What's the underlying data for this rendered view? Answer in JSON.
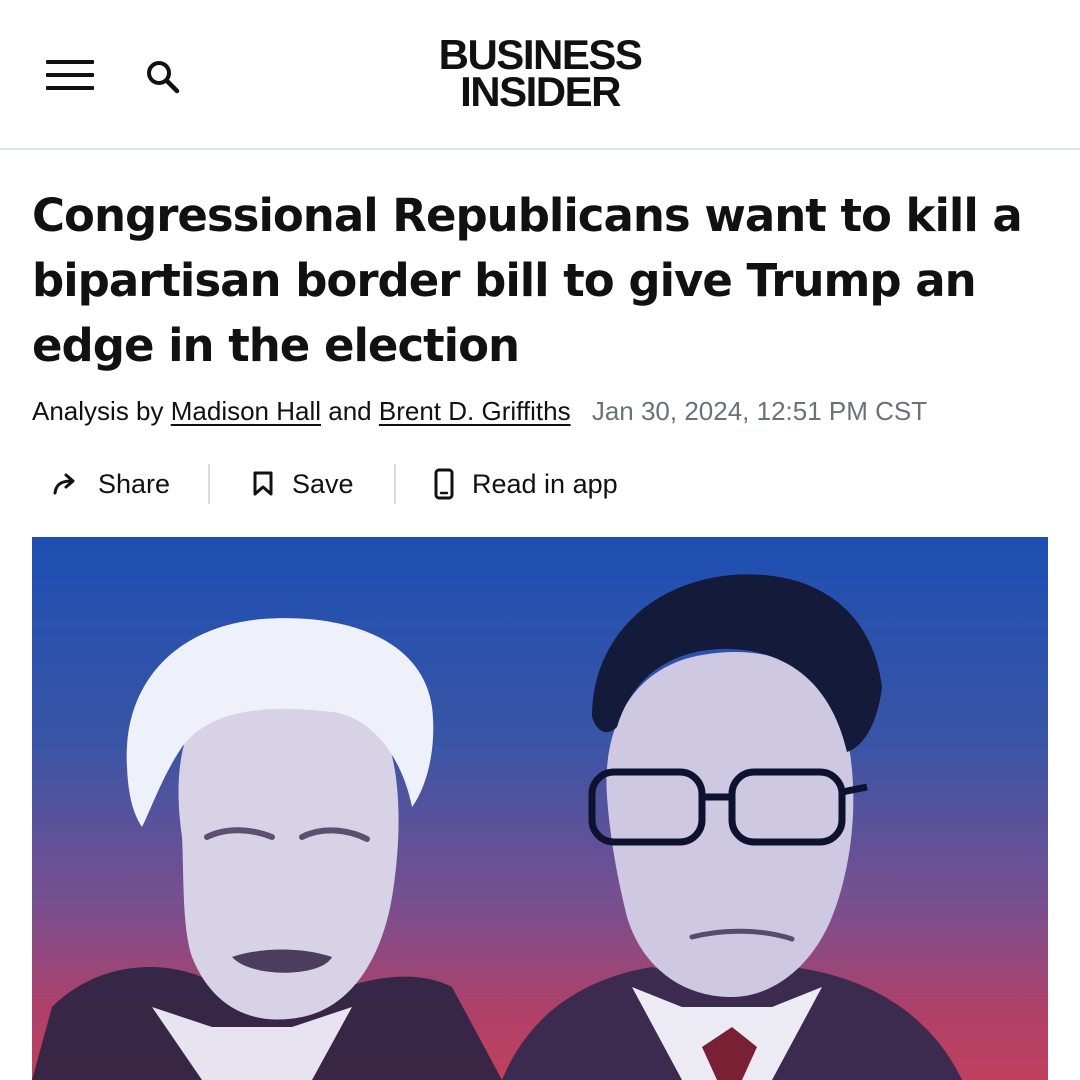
{
  "header": {
    "logo_line1": "BUSINESS",
    "logo_line2": "INSIDER"
  },
  "article": {
    "headline": "Congressional Republicans want to kill a bipartisan border bill to give Trump an edge in the election",
    "byline_prefix": "Analysis by",
    "author1": "Madison Hall",
    "byline_joiner": "and",
    "author2": "Brent D. Griffiths",
    "date": "Jan 30, 2024, 12:51 PM CST"
  },
  "actions": {
    "share": "Share",
    "save": "Save",
    "read_in_app": "Read in app"
  },
  "icons": {
    "menu": "hamburger-menu-icon",
    "search": "search-icon",
    "share": "share-arrow-icon",
    "save": "bookmark-icon",
    "app": "phone-icon"
  },
  "colors": {
    "date_gray": "#6a7278",
    "hero_top": "#1d4fb3",
    "hero_bottom": "#c0405e"
  }
}
